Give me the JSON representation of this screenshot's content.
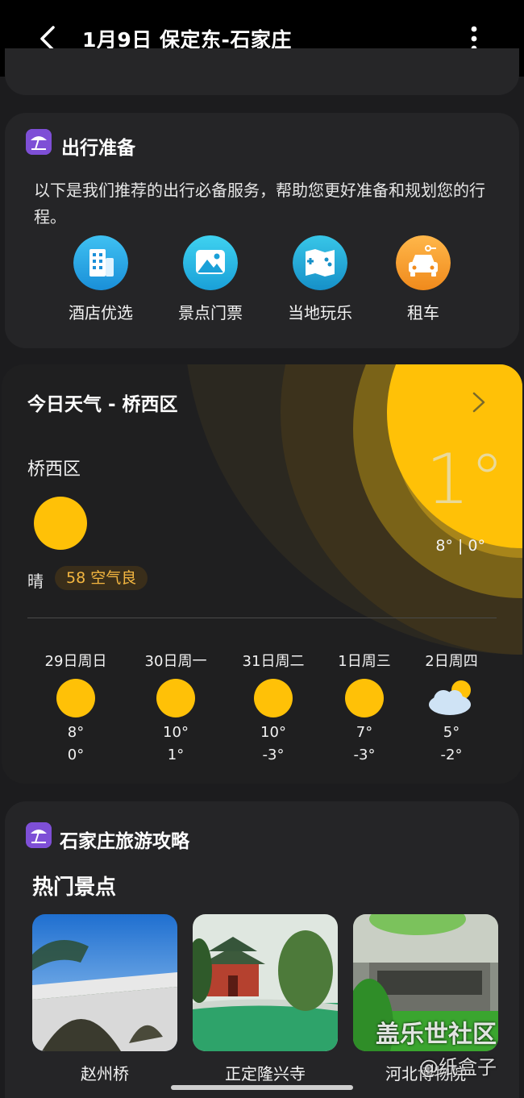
{
  "header": {
    "title": "1月9日 保定东-石家庄"
  },
  "travel_prep": {
    "title": "出行准备",
    "description": "以下是我们推荐的出行必备服务，帮助您更好准备和规划您的行程。",
    "services": [
      {
        "label": "酒店优选",
        "icon": "hotel-icon",
        "color": "#2b9fe6"
      },
      {
        "label": "景点门票",
        "icon": "scenic-icon",
        "color": "#21b8e0"
      },
      {
        "label": "当地玩乐",
        "icon": "map-play-icon",
        "color": "#1aa6d6"
      },
      {
        "label": "租车",
        "icon": "car-icon",
        "color": "#f5a623"
      }
    ]
  },
  "weather": {
    "title": "今日天气 - 桥西区",
    "location": "桥西区",
    "condition": "晴",
    "aqi": "58 空气良",
    "temp": "1°",
    "range": "8° | 0°",
    "forecast": [
      {
        "day": "29日周日",
        "icon": "sun-icon",
        "high": "8°",
        "low": "0°"
      },
      {
        "day": "30日周一",
        "icon": "sun-icon",
        "high": "10°",
        "low": "1°"
      },
      {
        "day": "31日周二",
        "icon": "sun-icon",
        "high": "10°",
        "low": "-3°"
      },
      {
        "day": "1日周三",
        "icon": "sun-icon",
        "high": "7°",
        "low": "-3°"
      },
      {
        "day": "2日周四",
        "icon": "partly-cloudy-icon",
        "high": "5°",
        "low": "-2°"
      }
    ],
    "accent": "#ffc107"
  },
  "guide": {
    "title": "石家庄旅游攻略",
    "subtitle": "热门景点",
    "spots": [
      {
        "label": "赵州桥"
      },
      {
        "label": "正定隆兴寺"
      },
      {
        "label": "河北博物院"
      }
    ]
  },
  "watermark": {
    "main": "盖乐世社区",
    "sub": "@纸盒子"
  }
}
